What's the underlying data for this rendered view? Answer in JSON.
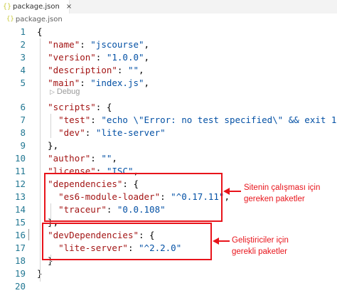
{
  "tab": {
    "icon": "json-braces-icon",
    "icon_glyph": "{}",
    "label": "package.json",
    "close_glyph": "×"
  },
  "breadcrumb": {
    "icon_glyph": "{}",
    "label": "package.json"
  },
  "codelens": {
    "play_glyph": "▷",
    "label": "Debug"
  },
  "lines": [
    {
      "n": "1",
      "parts": [
        [
          "p",
          "{"
        ]
      ]
    },
    {
      "n": "2",
      "parts": [
        [
          "p",
          "  "
        ],
        [
          "k",
          "\"name\""
        ],
        [
          "p",
          ": "
        ],
        [
          "s",
          "\"jscourse\""
        ],
        [
          "p",
          ","
        ]
      ]
    },
    {
      "n": "3",
      "parts": [
        [
          "p",
          "  "
        ],
        [
          "k",
          "\"version\""
        ],
        [
          "p",
          ": "
        ],
        [
          "s",
          "\"1.0.0\""
        ],
        [
          "p",
          ","
        ]
      ]
    },
    {
      "n": "4",
      "parts": [
        [
          "p",
          "  "
        ],
        [
          "k",
          "\"description\""
        ],
        [
          "p",
          ": "
        ],
        [
          "s",
          "\"\""
        ],
        [
          "p",
          ","
        ]
      ]
    },
    {
      "n": "5",
      "parts": [
        [
          "p",
          "  "
        ],
        [
          "k",
          "\"main\""
        ],
        [
          "p",
          ": "
        ],
        [
          "s",
          "\"index.js\""
        ],
        [
          "p",
          ","
        ]
      ]
    },
    {
      "n": "6",
      "parts": [
        [
          "p",
          "  "
        ],
        [
          "k",
          "\"scripts\""
        ],
        [
          "p",
          ": {"
        ]
      ]
    },
    {
      "n": "7",
      "parts": [
        [
          "p",
          "    "
        ],
        [
          "k",
          "\"test\""
        ],
        [
          "p",
          ": "
        ],
        [
          "s",
          "\"echo \\\"Error: no test specified\\\" && exit 1\""
        ]
      ]
    },
    {
      "n": "8",
      "parts": [
        [
          "p",
          "    "
        ],
        [
          "k",
          "\"dev\""
        ],
        [
          "p",
          ": "
        ],
        [
          "s",
          "\"lite-server\""
        ]
      ]
    },
    {
      "n": "9",
      "parts": [
        [
          "p",
          "  },"
        ]
      ]
    },
    {
      "n": "10",
      "parts": [
        [
          "p",
          "  "
        ],
        [
          "k",
          "\"author\""
        ],
        [
          "p",
          ": "
        ],
        [
          "s",
          "\"\""
        ],
        [
          "p",
          ","
        ]
      ]
    },
    {
      "n": "11",
      "parts": [
        [
          "p",
          "  "
        ],
        [
          "k",
          "\"license\""
        ],
        [
          "p",
          ": "
        ],
        [
          "s",
          "\"ISC\""
        ],
        [
          "p",
          ","
        ]
      ]
    },
    {
      "n": "12",
      "parts": [
        [
          "p",
          "  "
        ],
        [
          "k",
          "\"dependencies\""
        ],
        [
          "p",
          ": {"
        ]
      ]
    },
    {
      "n": "13",
      "parts": [
        [
          "p",
          "    "
        ],
        [
          "k",
          "\"es6-module-loader\""
        ],
        [
          "p",
          ": "
        ],
        [
          "s",
          "\"^0.17.11\""
        ],
        [
          "p",
          ","
        ]
      ]
    },
    {
      "n": "14",
      "parts": [
        [
          "p",
          "    "
        ],
        [
          "k",
          "\"traceur\""
        ],
        [
          "p",
          ": "
        ],
        [
          "s",
          "\"0.0.108\""
        ]
      ]
    },
    {
      "n": "15",
      "parts": [
        [
          "p",
          "  },"
        ]
      ]
    },
    {
      "n": "16",
      "parts": [
        [
          "p",
          "  "
        ],
        [
          "k",
          "\"devDependencies\""
        ],
        [
          "p",
          ": {"
        ]
      ]
    },
    {
      "n": "17",
      "parts": [
        [
          "p",
          "    "
        ],
        [
          "k",
          "\"lite-server\""
        ],
        [
          "p",
          ": "
        ],
        [
          "s",
          "\"^2.2.0\""
        ]
      ]
    },
    {
      "n": "18",
      "parts": [
        [
          "p",
          "  }"
        ]
      ]
    },
    {
      "n": "19",
      "parts": [
        [
          "p",
          "}"
        ]
      ]
    },
    {
      "n": "20",
      "parts": []
    }
  ],
  "annotations": {
    "dependencies_note": [
      "Sitenin çalışması için",
      "gereken paketler"
    ],
    "dev_dependencies_note": [
      "Geliştiriciler için",
      "gerekli paketler"
    ]
  },
  "colors": {
    "key": "#a31515",
    "string": "#0451a5",
    "line_number": "#237893",
    "annotation_red": "#e8141b"
  }
}
